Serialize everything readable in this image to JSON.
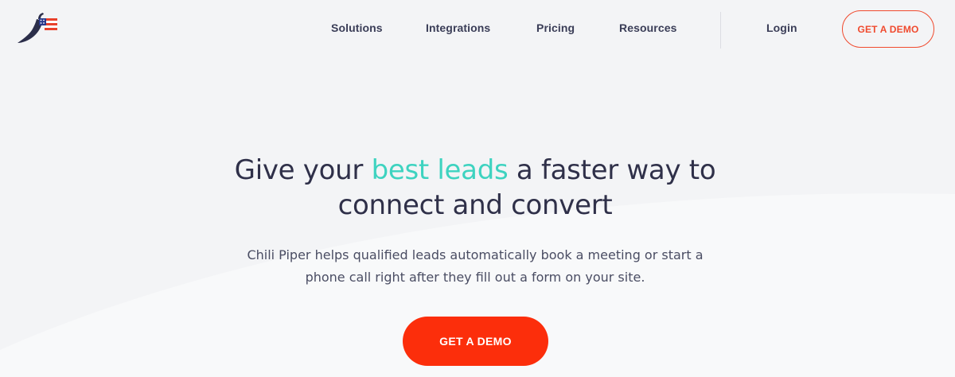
{
  "header": {
    "logo_icon": "chili-pepper-flag-logo",
    "nav": [
      {
        "label": "Solutions"
      },
      {
        "label": "Integrations"
      },
      {
        "label": "Pricing"
      },
      {
        "label": "Resources"
      }
    ],
    "login_label": "Login",
    "demo_label": "GET A DEMO"
  },
  "hero": {
    "title_before": "Give your ",
    "title_accent": "best leads",
    "title_after_line1": " a faster way to",
    "title_line2": "connect and convert",
    "subtitle_line1": "Chili Piper helps qualified leads automatically book a meeting or start a",
    "subtitle_line2": "phone call right after they fill out a form on your site.",
    "cta_label": "GET A DEMO"
  },
  "colors": {
    "accent_teal": "#3ed3c0",
    "brand_red": "#fc2e0b",
    "outline_red": "#f04a2e",
    "text_dark": "#2f3049",
    "background": "#f3f4f6"
  }
}
